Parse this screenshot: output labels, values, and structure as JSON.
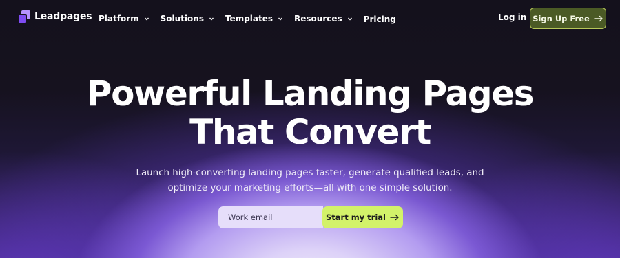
{
  "brand": {
    "name": "Leadpages"
  },
  "nav": {
    "items": [
      {
        "label": "Platform",
        "dropdown": true
      },
      {
        "label": "Solutions",
        "dropdown": true
      },
      {
        "label": "Templates",
        "dropdown": true
      },
      {
        "label": "Resources",
        "dropdown": true
      },
      {
        "label": "Pricing",
        "dropdown": false
      }
    ],
    "login_label": "Log in",
    "signup_label": "Sign Up Free"
  },
  "hero": {
    "title_line1": "Powerful Landing Pages",
    "title_line2": "That Convert",
    "subtitle_line1": "Launch high-converting landing pages faster, generate qualified leads, and",
    "subtitle_line2": "optimize your marketing efforts—all with one simple solution.",
    "email_placeholder": "Work email",
    "cta_label": "Start my trial"
  },
  "colors": {
    "accent_lime": "#d3f26a",
    "signup_bg": "#4b5a25",
    "brand_purple": "#7f4cf2",
    "background_dark": "#15121f"
  },
  "icons": {
    "logo": "leadpages-logo-icon",
    "dropdown": "chevron-down-icon",
    "arrow": "arrow-right-icon"
  }
}
